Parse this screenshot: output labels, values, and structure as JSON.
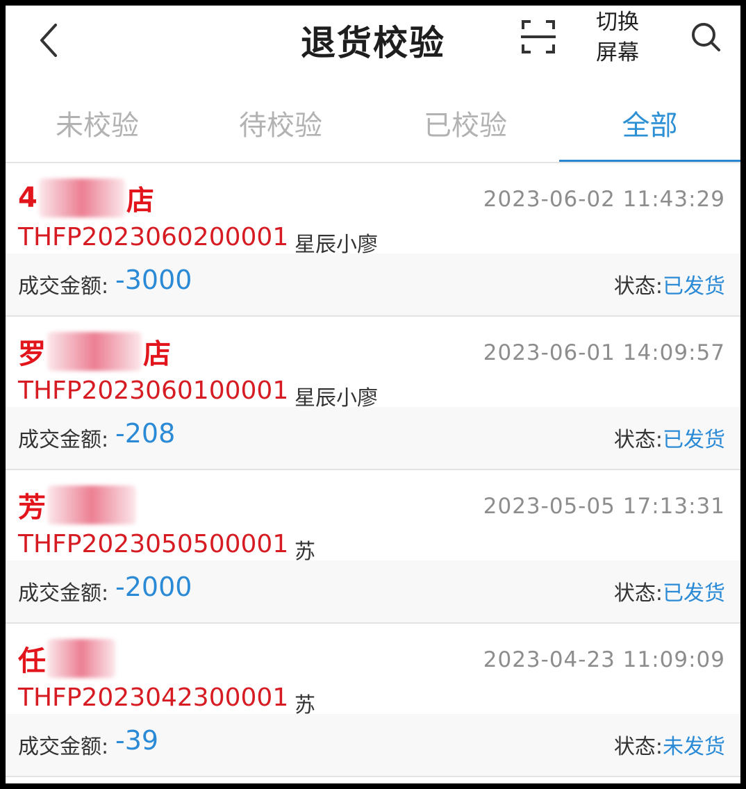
{
  "header": {
    "title": "退货校验",
    "switch_line1": "切换",
    "switch_line2": "屏幕"
  },
  "icons": {
    "back": "chevron-left-icon",
    "scan": "scan-icon",
    "search": "search-icon"
  },
  "colors": {
    "accent": "#2a86cf",
    "shop_red": "#e2141c",
    "order_red": "#d61c22",
    "muted": "#b2b2b2"
  },
  "tabs": [
    {
      "label": "未校验",
      "active": false
    },
    {
      "label": "待校验",
      "active": false
    },
    {
      "label": "已校验",
      "active": false
    },
    {
      "label": "全部",
      "active": true
    }
  ],
  "orders": [
    {
      "shop_prefix": "4",
      "shop_suffix": "店",
      "time": "2023-06-02 11:43:29",
      "order_no": "THFP2023060200001",
      "person": "星辰小廖",
      "amount_label": "成交金额:",
      "amount": "-3000",
      "status_label": "状态:",
      "status": "已发货"
    },
    {
      "shop_prefix": "罗",
      "shop_suffix": "店",
      "time": "2023-06-01 14:09:57",
      "order_no": "THFP2023060100001",
      "person": "星辰小廖",
      "amount_label": "成交金额:",
      "amount": "-208",
      "status_label": "状态:",
      "status": "已发货"
    },
    {
      "shop_prefix": "芳",
      "shop_suffix": "",
      "time": "2023-05-05 17:13:31",
      "order_no": "THFP2023050500001",
      "person": "苏",
      "amount_label": "成交金额:",
      "amount": "-2000",
      "status_label": "状态:",
      "status": "已发货"
    },
    {
      "shop_prefix": "任",
      "shop_suffix": "",
      "time": "2023-04-23 11:09:09",
      "order_no": "THFP2023042300001",
      "person": "苏",
      "amount_label": "成交金额:",
      "amount": "-39",
      "status_label": "状态:",
      "status": "未发货"
    }
  ]
}
